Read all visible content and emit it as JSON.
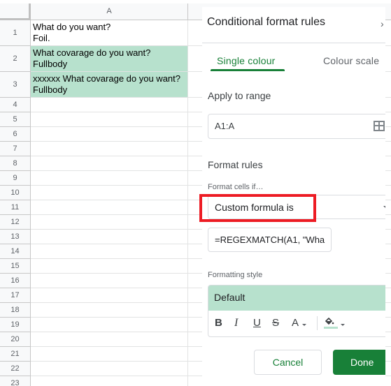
{
  "sheet": {
    "columns": [
      "A",
      ""
    ],
    "rows": [
      {
        "num": "1",
        "text": "What do you want?\nFoil.",
        "highlighted": false
      },
      {
        "num": "2",
        "text": "What covarage do you want?\nFullbody",
        "highlighted": true
      },
      {
        "num": "3",
        "text": "xxxxxx What covarage do you want?\nFullbody",
        "highlighted": true
      },
      {
        "num": "4",
        "text": "",
        "highlighted": false
      },
      {
        "num": "5",
        "text": "",
        "highlighted": false
      },
      {
        "num": "6",
        "text": "",
        "highlighted": false
      },
      {
        "num": "7",
        "text": "",
        "highlighted": false
      },
      {
        "num": "8",
        "text": "",
        "highlighted": false
      },
      {
        "num": "9",
        "text": "",
        "highlighted": false
      },
      {
        "num": "10",
        "text": "",
        "highlighted": false
      },
      {
        "num": "11",
        "text": "",
        "highlighted": false
      },
      {
        "num": "12",
        "text": "",
        "highlighted": false
      },
      {
        "num": "13",
        "text": "",
        "highlighted": false
      },
      {
        "num": "14",
        "text": "",
        "highlighted": false
      },
      {
        "num": "15",
        "text": "",
        "highlighted": false
      },
      {
        "num": "16",
        "text": "",
        "highlighted": false
      },
      {
        "num": "17",
        "text": "",
        "highlighted": false
      },
      {
        "num": "18",
        "text": "",
        "highlighted": false
      },
      {
        "num": "19",
        "text": "",
        "highlighted": false
      },
      {
        "num": "20",
        "text": "",
        "highlighted": false
      },
      {
        "num": "21",
        "text": "",
        "highlighted": false
      },
      {
        "num": "22",
        "text": "",
        "highlighted": false
      },
      {
        "num": "23",
        "text": "",
        "highlighted": false
      }
    ],
    "highlight_color": "#b7e1cd"
  },
  "panel": {
    "title": "Conditional format rules",
    "close_icon": "chevron-right-icon",
    "tabs": [
      {
        "label": "Single colour",
        "active": true
      },
      {
        "label": "Colour scale",
        "active": false
      }
    ],
    "apply_range_label": "Apply to range",
    "range_value": "A1:A",
    "range_icon": "select-range-grid-icon",
    "format_rules_label": "Format rules",
    "format_cells_if_label": "Format cells if…",
    "condition_value": "Custom formula is",
    "formula_value": "=REGEXMATCH(A1, \"Wha",
    "formatting_style_label": "Formatting style",
    "style_preview": "Default",
    "toolbar": {
      "bold": "B",
      "italic": "I",
      "underline": "U",
      "strikethrough": "S",
      "text_color": "A"
    },
    "cancel_label": "Cancel",
    "done_label": "Done",
    "accent_color": "#188038"
  },
  "annotation": {
    "color": "#ed1c24",
    "target": "condition-select"
  }
}
